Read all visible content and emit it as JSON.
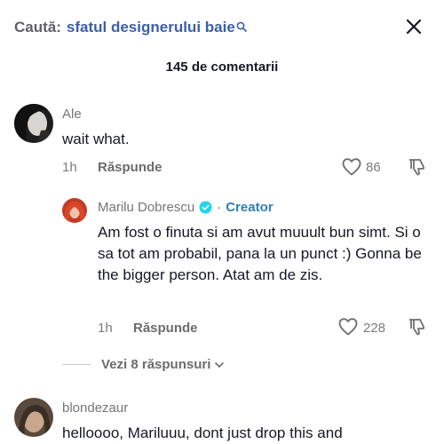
{
  "header": {
    "search_prefix": "Caută:",
    "search_term": "sfatul designerului baie",
    "close_icon": "close-icon"
  },
  "comment_count": "145 de comentarii",
  "comments": [
    {
      "author": "Ale",
      "text": "wait what.",
      "time": "1h",
      "reply_label": "Răspunde",
      "likes": "86"
    },
    {
      "author": "blondezaur",
      "text": "helloooo, Mariluuu, dont just drop this and"
    }
  ],
  "reply": {
    "author": "Marilu Dobrescu",
    "separator": "·",
    "badge": "Creator",
    "text": "Am fost o finuta si am avut muuult bun simt. Si o sa tot am probabil, pana la un punct :) Gonna be the bigger person. Atat am de zis.",
    "time": "1h",
    "reply_label": "Răspunde",
    "likes": "228"
  },
  "view_more": "Vezi 8 răspunsuri",
  "colors": {
    "accent_link": "#3d5ea8",
    "creator": "#2f7fb4",
    "verified": "#20d5ec"
  }
}
